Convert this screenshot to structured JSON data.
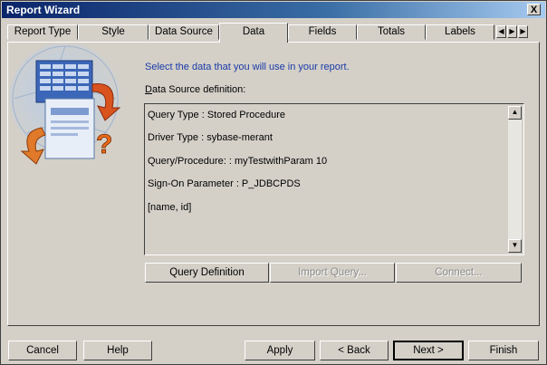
{
  "window": {
    "title": "Report Wizard",
    "close_glyph": "X"
  },
  "tabs": [
    {
      "label": "Report Type"
    },
    {
      "label": "Style"
    },
    {
      "label": "Data Source"
    },
    {
      "label": "Data"
    },
    {
      "label": "Fields"
    },
    {
      "label": "Totals"
    },
    {
      "label": "Labels"
    }
  ],
  "active_tab": "Data",
  "content": {
    "instruction": "Select the data that you will use in your report.",
    "definition_label_hotkey": "D",
    "definition_label_rest": "ata Source definition:",
    "definition_lines": [
      "Query Type : Stored Procedure",
      "Driver Type : sybase-merant",
      "Query/Procedure: : myTestwithParam 10",
      "Sign-On Parameter :  P_JDBCPDS",
      "[name, id]"
    ],
    "buttons": {
      "query_definition": "Query Definition",
      "import_query": "Import Query...",
      "connect": "Connect..."
    }
  },
  "footer": {
    "cancel": "Cancel",
    "help": "Help",
    "apply": "Apply",
    "back": "< Back",
    "next": "Next >",
    "finish": "Finish"
  },
  "colors": {
    "instruction": "#1a3aa8",
    "title_start": "#0a246a"
  }
}
